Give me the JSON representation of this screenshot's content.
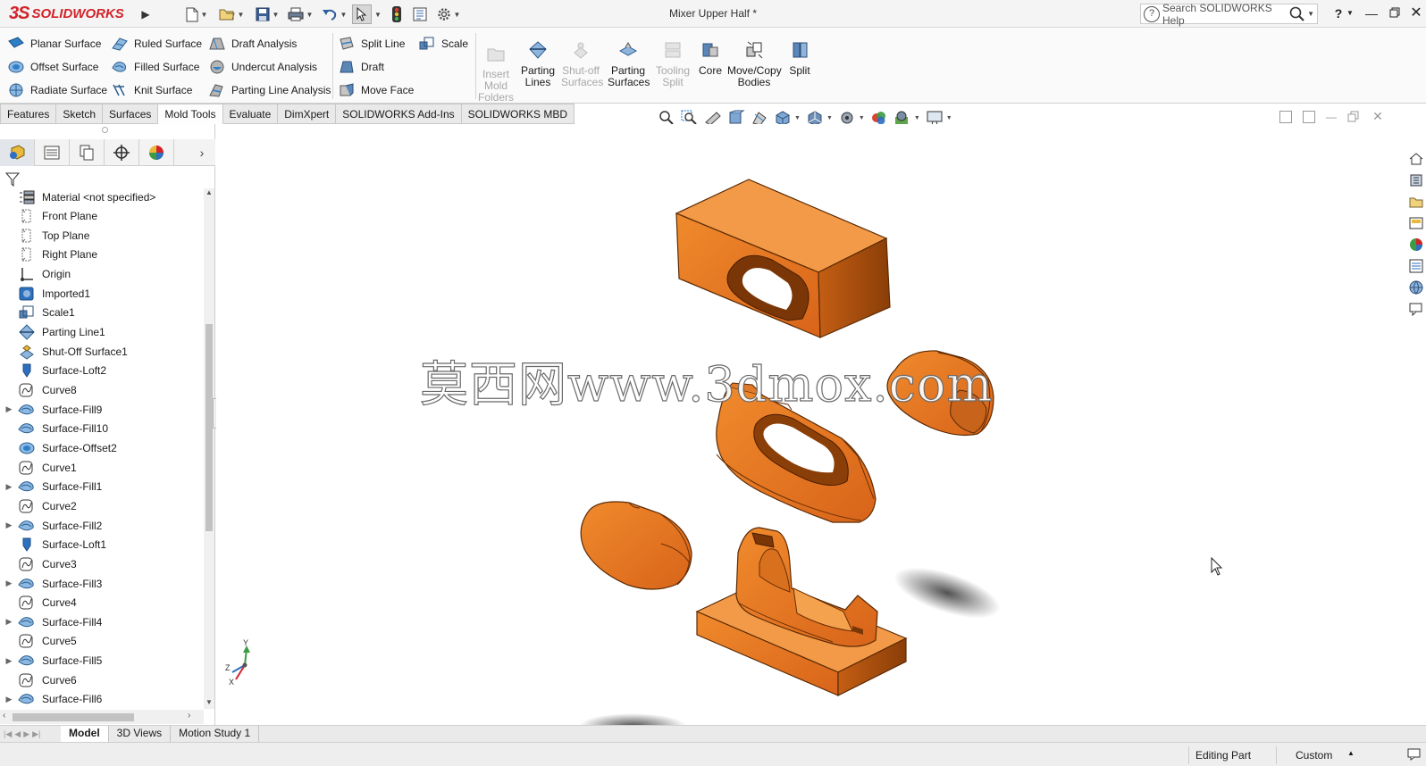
{
  "titlebar": {
    "brand_ds": "3S",
    "brand": "SOLIDWORKS",
    "document_title": "Mixer Upper Half *",
    "search_placeholder": "Search SOLIDWORKS Help",
    "help_label": "?"
  },
  "commands": {
    "planar_surface": "Planar Surface",
    "offset_surface": "Offset Surface",
    "radiate_surface": "Radiate Surface",
    "ruled_surface": "Ruled Surface",
    "filled_surface": "Filled Surface",
    "knit_surface": "Knit Surface",
    "draft_analysis": "Draft Analysis",
    "undercut_analysis": "Undercut Analysis",
    "parting_line_analysis": "Parting Line Analysis",
    "split_line": "Split Line",
    "draft": "Draft",
    "move_face": "Move Face",
    "scale": "Scale",
    "insert_mold_folders_l1": "Insert",
    "insert_mold_folders_l2": "Mold",
    "insert_mold_folders_l3": "Folders",
    "parting_lines_l1": "Parting",
    "parting_lines_l2": "Lines",
    "shutoff_l1": "Shut-off",
    "shutoff_l2": "Surfaces",
    "parting_surfaces_l1": "Parting",
    "parting_surfaces_l2": "Surfaces",
    "tooling_split_l1": "Tooling",
    "tooling_split_l2": "Split",
    "core": "Core",
    "move_copy_l1": "Move/Copy",
    "move_copy_l2": "Bodies",
    "split": "Split"
  },
  "tabs": [
    "Features",
    "Sketch",
    "Surfaces",
    "Mold Tools",
    "Evaluate",
    "DimXpert",
    "SOLIDWORKS Add-Ins",
    "SOLIDWORKS MBD"
  ],
  "active_tab": "Mold Tools",
  "tree": [
    {
      "label": "Material <not specified>",
      "icon": "material-icon",
      "expandable": false
    },
    {
      "label": "Front Plane",
      "icon": "plane-icon",
      "expandable": false
    },
    {
      "label": "Top Plane",
      "icon": "plane-icon",
      "expandable": false
    },
    {
      "label": "Right Plane",
      "icon": "plane-icon",
      "expandable": false
    },
    {
      "label": "Origin",
      "icon": "origin-icon",
      "expandable": false
    },
    {
      "label": "Imported1",
      "icon": "imported-icon",
      "expandable": false
    },
    {
      "label": "Scale1",
      "icon": "scale-icon",
      "expandable": false
    },
    {
      "label": "Parting Line1",
      "icon": "parting-line-icon",
      "expandable": false
    },
    {
      "label": "Shut-Off Surface1",
      "icon": "shutoff-surface-icon",
      "expandable": false
    },
    {
      "label": "Surface-Loft2",
      "icon": "surface-loft-icon",
      "expandable": false
    },
    {
      "label": "Curve8",
      "icon": "curve-icon",
      "expandable": false
    },
    {
      "label": "Surface-Fill9",
      "icon": "surface-fill-icon",
      "expandable": true
    },
    {
      "label": "Surface-Fill10",
      "icon": "surface-fill-icon",
      "expandable": false
    },
    {
      "label": "Surface-Offset2",
      "icon": "surface-offset-icon",
      "expandable": false
    },
    {
      "label": "Curve1",
      "icon": "curve-icon",
      "expandable": false
    },
    {
      "label": "Surface-Fill1",
      "icon": "surface-fill-icon",
      "expandable": true
    },
    {
      "label": "Curve2",
      "icon": "curve-icon",
      "expandable": false
    },
    {
      "label": "Surface-Fill2",
      "icon": "surface-fill-icon",
      "expandable": true
    },
    {
      "label": "Surface-Loft1",
      "icon": "surface-loft-icon",
      "expandable": false
    },
    {
      "label": "Curve3",
      "icon": "curve-icon",
      "expandable": false
    },
    {
      "label": "Surface-Fill3",
      "icon": "surface-fill-icon",
      "expandable": true
    },
    {
      "label": "Curve4",
      "icon": "curve-icon",
      "expandable": false
    },
    {
      "label": "Surface-Fill4",
      "icon": "surface-fill-icon",
      "expandable": true
    },
    {
      "label": "Curve5",
      "icon": "curve-icon",
      "expandable": false
    },
    {
      "label": "Surface-Fill5",
      "icon": "surface-fill-icon",
      "expandable": true
    },
    {
      "label": "Curve6",
      "icon": "curve-icon",
      "expandable": false
    },
    {
      "label": "Surface-Fill6",
      "icon": "surface-fill-icon",
      "expandable": true
    }
  ],
  "bottom_tabs": [
    "Model",
    "3D Views",
    "Motion Study 1"
  ],
  "active_bottom_tab": "Model",
  "status": {
    "mode": "Editing Part",
    "units": "Custom"
  },
  "viewport": {
    "watermark": "莫西网www.3dmox.com",
    "triad_y": "Y",
    "triad_z": "Z",
    "triad_x": "X"
  },
  "colors": {
    "brand_red": "#d2232a",
    "model_orange": "#e8741a",
    "model_orange_dark": "#a64a0c"
  }
}
